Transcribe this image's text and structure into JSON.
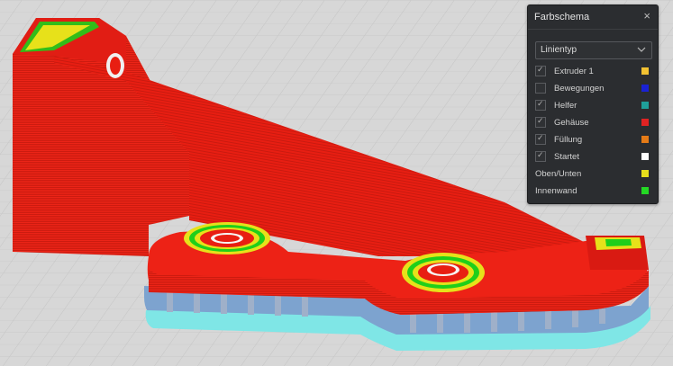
{
  "panel": {
    "title": "Farbschema",
    "close_glyph": "×",
    "dropdown": {
      "selected": "Linientyp"
    },
    "items": [
      {
        "label": "Extruder 1",
        "checked": true,
        "color": "#f2c232"
      },
      {
        "label": "Bewegungen",
        "checked": false,
        "color": "#1a22d4"
      },
      {
        "label": "Helfer",
        "checked": true,
        "color": "#1f9f9a"
      },
      {
        "label": "Gehäuse",
        "checked": true,
        "color": "#e02323"
      },
      {
        "label": "Füllung",
        "checked": true,
        "color": "#e57b17"
      },
      {
        "label": "Startet",
        "checked": true,
        "color": "#ffffff"
      },
      {
        "label": "Oben/Unten",
        "color": "#e6de1c"
      },
      {
        "label": "Innenwand",
        "color": "#24d824"
      }
    ]
  },
  "icons": {
    "close": "close-icon",
    "chevron": "chevron-down-icon",
    "check": "checkmark-icon"
  }
}
